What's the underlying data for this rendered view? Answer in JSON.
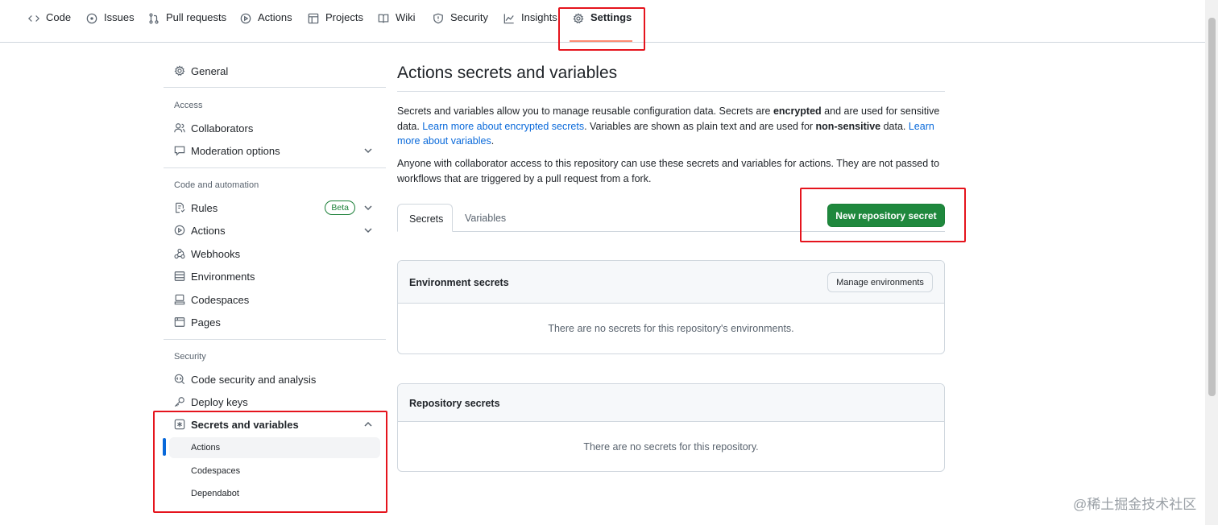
{
  "topnav": {
    "tabs": [
      {
        "label": "Code",
        "icon": "code-icon"
      },
      {
        "label": "Issues",
        "icon": "issue-icon"
      },
      {
        "label": "Pull requests",
        "icon": "pull-request-icon"
      },
      {
        "label": "Actions",
        "icon": "play-icon"
      },
      {
        "label": "Projects",
        "icon": "table-icon"
      },
      {
        "label": "Wiki",
        "icon": "book-icon"
      },
      {
        "label": "Security",
        "icon": "shield-icon"
      },
      {
        "label": "Insights",
        "icon": "graph-icon"
      },
      {
        "label": "Settings",
        "icon": "gear-icon",
        "active": true
      }
    ]
  },
  "sidebar": {
    "general": "General",
    "access_heading": "Access",
    "collaborators": "Collaborators",
    "moderation": "Moderation options",
    "code_heading": "Code and automation",
    "rules": "Rules",
    "rules_badge": "Beta",
    "actions": "Actions",
    "webhooks": "Webhooks",
    "environments": "Environments",
    "codespaces": "Codespaces",
    "pages": "Pages",
    "security_heading": "Security",
    "code_security": "Code security and analysis",
    "deploy_keys": "Deploy keys",
    "secrets": "Secrets and variables",
    "sub_items": [
      "Actions",
      "Codespaces",
      "Dependabot"
    ]
  },
  "main": {
    "title": "Actions secrets and variables",
    "para1": {
      "t1": "Secrets and variables allow you to manage reusable configuration data. Secrets are ",
      "b1": "encrypted",
      "t2": " and are used for sensitive data. ",
      "link1": "Learn more about encrypted secrets",
      "t3": ". Variables are shown as plain text and are used for ",
      "b2": "non-sensitive",
      "t4": " data. ",
      "link2": "Learn more about variables",
      "t5": "."
    },
    "para2": "Anyone with collaborator access to this repository can use these secrets and variables for actions. They are not passed to workflows that are triggered by a pull request from a fork.",
    "tabs": [
      "Secrets",
      "Variables"
    ],
    "new_secret_button": "New repository secret",
    "env_secrets": {
      "title": "Environment secrets",
      "button": "Manage environments",
      "empty": "There are no secrets for this repository's environments."
    },
    "repo_secrets": {
      "title": "Repository secrets",
      "empty": "There are no secrets for this repository."
    }
  },
  "watermark": "@稀土掘金技术社区",
  "colors": {
    "primary_button": "#1f883d",
    "link": "#0969da",
    "highlight_box": "#e5141d",
    "active_underline": "#fd8c73"
  }
}
